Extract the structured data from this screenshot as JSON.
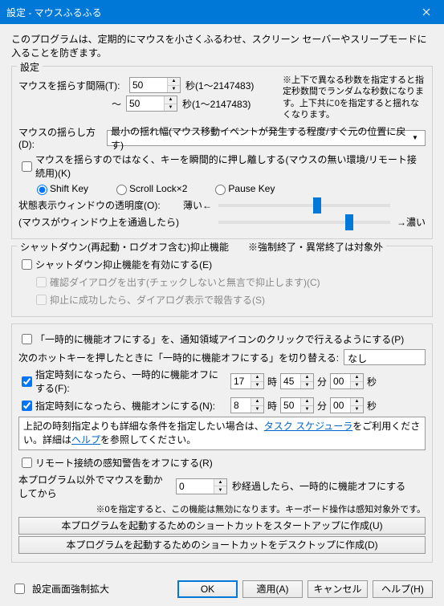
{
  "titlebar": {
    "title": "設定 - マウスふるふる"
  },
  "description": "このプログラムは、定期的にマウスを小さくふるわせ、スクリーン セーバーやスリープモードに入ることを防ぎます。",
  "group_settings": {
    "legend": "設定",
    "interval_label": "マウスを揺らす間隔(T):",
    "interval_from": "50",
    "interval_to": "50",
    "interval_unit": "秒(1～2147483)",
    "interval_note": "※上下で異なる秒数を指定すると指定秒数間でランダムな秒数になります。上下共に0を指定すると揺れなくなります。",
    "tilde": "～",
    "method_label": "マウスの揺らし方(D):",
    "method_combo": "最小の揺れ幅(マウス移動イベントが発生する程度/すぐ元の位置に戻す)",
    "chk_keypress": "マウスを揺らすのではなく、キーを瞬間的に押し離しする(マウスの無い環境/リモート接続用)(K)",
    "radio_shift": "Shift Key",
    "radio_scroll": "Scroll Lock×2",
    "radio_pause": "Pause Key",
    "slider1_label": "状態表示ウィンドウの透明度(O):",
    "slider2_label": "(マウスがウィンドウ上を通過したら)",
    "slider_thin": "薄い←",
    "slider_thick": "→濃い"
  },
  "group_shutdown": {
    "legend": "シャットダウン(再起動・ログオフ含む)抑止機能　　※強制終了・異常終了は対象外",
    "chk_enable": "シャットダウン抑止機能を有効にする(E)",
    "chk_confirm": "確認ダイアログを出す(チェックしないと無言で抑止します)(C)",
    "chk_report": "抑止に成功したら、ダイアログ表示で報告する(S)"
  },
  "group_temp": {
    "chk_notify": "「一時的に機能オフにする」を、通知領域アイコンのクリックで行えるようにする(P)",
    "hotkey_label": "次のホットキーを押したときに「一時的に機能オフにする」を切り替える:",
    "hotkey_value": "なし",
    "chk_off_at": "指定時刻になったら、一時的に機能オフにする(F):",
    "off_h": "17",
    "off_m": "45",
    "off_s": "00",
    "chk_on_at": "指定時刻になったら、機能オンにする(N):",
    "on_h": "8",
    "on_m": "50",
    "on_s": "00",
    "unit_h": "時",
    "unit_m": "分",
    "unit_s": "秒",
    "info_pre": "上記の時刻指定よりも詳細な条件を指定したい場合は、",
    "info_link1": "タスク スケジューラ",
    "info_mid": "をご利用ください。詳細は",
    "info_link2": "ヘルプ",
    "info_post": "を参照してください。",
    "chk_remote": "リモート接続の感知警告をオフにする(R)",
    "idle_label": "本プログラム以外でマウスを動かしてから",
    "idle_value": "0",
    "idle_suffix": "秒経過したら、一時的に機能オフにする",
    "idle_note": "※0を指定すると、この機能は無効になります。キーボード操作は感知対象外です。",
    "btn_startup": "本プログラムを起動するためのショートカットをスタートアップに作成(U)",
    "btn_desktop": "本プログラムを起動するためのショートカットをデスクトップに作成(D)"
  },
  "footer": {
    "chk_force_expand": "設定画面強制拡大",
    "ok": "OK",
    "apply": "適用(A)",
    "cancel": "キャンセル",
    "help": "ヘルプ(H)"
  }
}
